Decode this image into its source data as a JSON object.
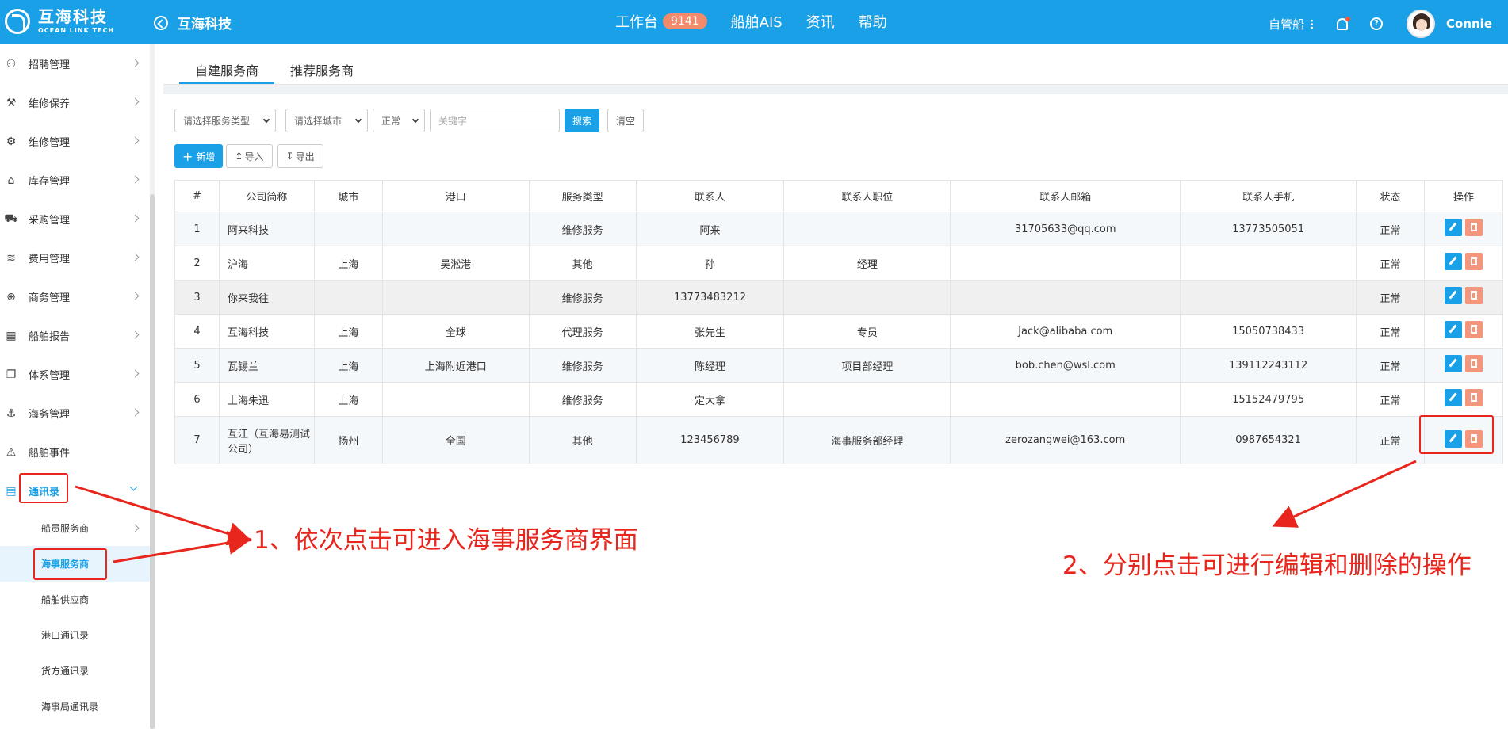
{
  "header": {
    "logo_cn": "互海科技",
    "logo_en": "OCEAN LINK TECH",
    "back_title": "互海科技",
    "nav": [
      {
        "label": "工作台",
        "badge": "9141"
      },
      {
        "label": "船舶AIS"
      },
      {
        "label": "资讯"
      },
      {
        "label": "帮助"
      }
    ],
    "role": "自管船",
    "user": "Connie"
  },
  "sidebar": {
    "items": [
      {
        "label": "招聘管理",
        "icon": "user-icon"
      },
      {
        "label": "维修保养",
        "icon": "hammer-icon"
      },
      {
        "label": "维修管理",
        "icon": "wrench-icon"
      },
      {
        "label": "库存管理",
        "icon": "home-icon"
      },
      {
        "label": "采购管理",
        "icon": "cart-icon"
      },
      {
        "label": "费用管理",
        "icon": "coins-icon"
      },
      {
        "label": "商务管理",
        "icon": "globe-icon"
      },
      {
        "label": "船舶报告",
        "icon": "calendar-icon"
      },
      {
        "label": "体系管理",
        "icon": "docs-icon"
      },
      {
        "label": "海务管理",
        "icon": "anchor-icon"
      },
      {
        "label": "船舶事件",
        "icon": "warning-icon"
      },
      {
        "label": "通讯录",
        "icon": "contacts-icon"
      }
    ],
    "sub_items": [
      {
        "label": "船员服务商"
      },
      {
        "label": "海事服务商"
      },
      {
        "label": "船舶供应商"
      },
      {
        "label": "港口通讯录"
      },
      {
        "label": "货方通讯录"
      },
      {
        "label": "海事局通讯录"
      }
    ]
  },
  "tabs": [
    "自建服务商",
    "推荐服务商"
  ],
  "filters": {
    "service_type": "请选择服务类型",
    "city": "请选择城市",
    "status": "正常",
    "keyword_placeholder": "关键字",
    "search": "搜索",
    "clear": "清空"
  },
  "actions": {
    "add": "新增",
    "import": "导入",
    "export": "导出"
  },
  "table": {
    "headers": [
      "#",
      "公司简称",
      "城市",
      "港口",
      "服务类型",
      "联系人",
      "联系人职位",
      "联系人邮箱",
      "联系人手机",
      "状态",
      "操作"
    ],
    "rows": [
      [
        "1",
        "阿来科技",
        "",
        "",
        "维修服务",
        "阿来",
        "",
        "31705633@qq.com",
        "13773505051",
        "正常"
      ],
      [
        "2",
        "沪海",
        "上海",
        "吴淞港",
        "其他",
        "孙",
        "经理",
        "",
        "",
        "正常"
      ],
      [
        "3",
        "你来我往",
        "",
        "",
        "维修服务",
        "13773483212",
        "",
        "",
        "",
        "正常"
      ],
      [
        "4",
        "互海科技",
        "上海",
        "全球",
        "代理服务",
        "张先生",
        "专员",
        "Jack@alibaba.com",
        "15050738433",
        "正常"
      ],
      [
        "5",
        "瓦锡兰",
        "上海",
        "上海附近港口",
        "维修服务",
        "陈经理",
        "项目部经理",
        "bob.chen@wsl.com",
        "139112243112",
        "正常"
      ],
      [
        "6",
        "上海朱迅",
        "上海",
        "",
        "维修服务",
        "定大拿",
        "",
        "",
        "15152479795",
        "正常"
      ],
      [
        "7",
        "互江（互海易测试公司）",
        "扬州",
        "全国",
        "其他",
        "123456789",
        "海事服务部经理",
        "zerozangwei@163.com",
        "0987654321",
        "正常"
      ]
    ]
  },
  "annotations": {
    "step1": "1、依次点击可进入海事服务商界面",
    "step2": "2、分别点击可进行编辑和删除的操作",
    "color": "#e8261d"
  },
  "colors": {
    "primary": "#1aa0e6",
    "badge": "#f28b6c",
    "delete": "#f3967c"
  }
}
